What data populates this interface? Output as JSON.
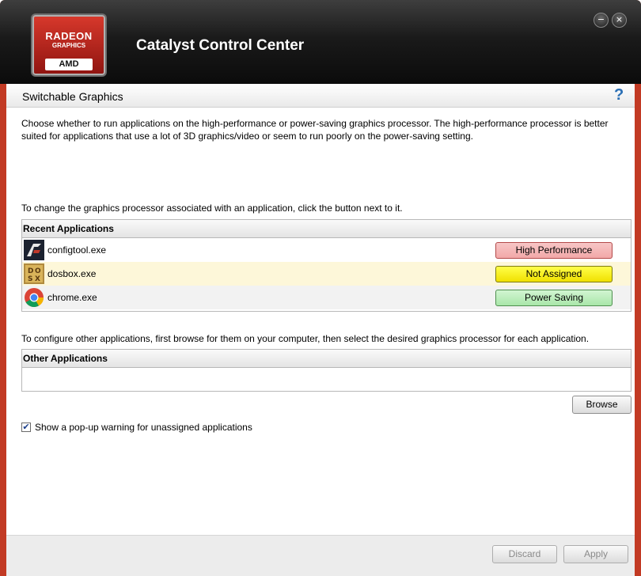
{
  "window": {
    "title": "Catalyst Control Center",
    "logo": {
      "line1": "RADEON",
      "line2": "GRAPHICS",
      "brand": "AMD"
    },
    "minimize_glyph": "−",
    "close_glyph": "×"
  },
  "page": {
    "title": "Switchable Graphics",
    "help_glyph": "?",
    "description": "Choose whether to run applications on the high-performance or power-saving graphics processor. The high-performance processor is better suited for applications that use a lot of 3D graphics/video or seem to run poorly on the power-saving setting.",
    "change_instruction": "To change the graphics processor associated with an application, click the button next to it."
  },
  "recent": {
    "header": "Recent Applications",
    "items": [
      {
        "name": "configtool.exe",
        "icon": "nfs-app-icon",
        "setting": "High Performance"
      },
      {
        "name": "dosbox.exe",
        "icon": "dosbox-app-icon",
        "setting": "Not Assigned"
      },
      {
        "name": "chrome.exe",
        "icon": "chrome-app-icon",
        "setting": "Power Saving"
      }
    ]
  },
  "other": {
    "instruction": "To configure other applications, first browse for them on your computer, then select the desired graphics processor for each application.",
    "header": "Other Applications",
    "browse_label": "Browse"
  },
  "warning": {
    "label": "Show a pop-up warning for unassigned applications",
    "checked": true,
    "check_glyph": "✔"
  },
  "footer": {
    "discard_label": "Discard",
    "apply_label": "Apply"
  },
  "colors": {
    "frame": "#c23a24",
    "high_performance": "#f2a8a8",
    "not_assigned": "#f0e000",
    "power_saving": "#a9e6a9"
  }
}
